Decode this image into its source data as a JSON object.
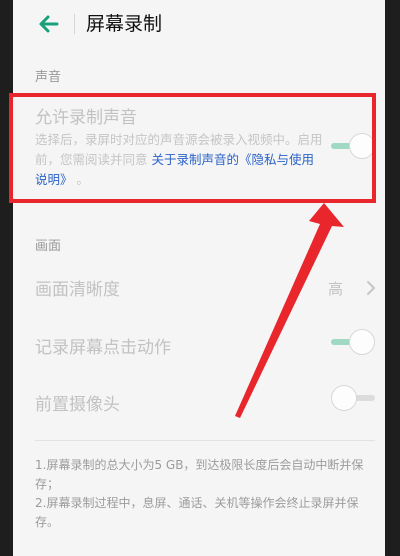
{
  "header": {
    "title": "屏幕录制",
    "back_icon": "arrow-left-icon"
  },
  "sound_section": {
    "label": "声音",
    "record_sound": {
      "title": "允许录制声音",
      "desc_text": "选择后，录屏时对应的声音源会被录入视频中。启用前，您需阅读并同意",
      "desc_link": "关于录制声音的《隐私与使用说明》",
      "desc_end": "。",
      "enabled": true
    }
  },
  "video_section": {
    "label": "画面",
    "quality": {
      "title": "画面清晰度",
      "value": "高"
    },
    "record_touches": {
      "title": "记录屏幕点击动作",
      "enabled": true
    },
    "front_camera": {
      "title": "前置摄像头",
      "enabled": false
    }
  },
  "notes": [
    "1.屏幕录制的总大小为5 GB，到达极限长度后会自动中断并保存；",
    "2.屏幕录制过程中，息屏、通话、关机等操作会终止录屏并保存。"
  ],
  "colors": {
    "accent": "#2a63c8",
    "toggle_on": "#9fd9c4",
    "highlight": "#e8262b",
    "back_arrow": "#17a07a"
  }
}
